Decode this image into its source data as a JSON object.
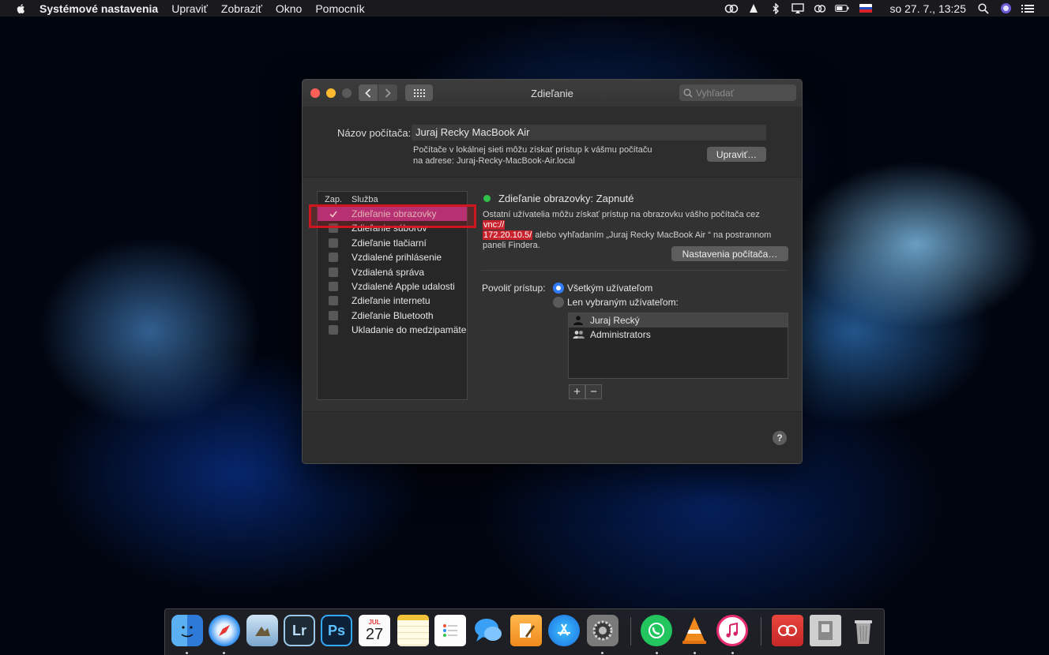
{
  "menubar": {
    "app_name": "Systémové nastavenia",
    "menus": [
      "Upraviť",
      "Zobraziť",
      "Okno",
      "Pomocník"
    ],
    "clock": "so 27. 7.,  13:25"
  },
  "window": {
    "title": "Zdieľanie",
    "search_placeholder": "Vyhľadať",
    "computer_name_label": "Názov počítača:",
    "computer_name": "Juraj Recky MacBook Air",
    "address_note_line1": "Počítače v lokálnej sieti môžu získať prístup k vášmu počítaču",
    "address_note_line2": "na adrese: Juraj-Recky-MacBook-Air.local",
    "edit_button": "Upraviť…",
    "table_header_on": "Zap.",
    "table_header_service": "Služba",
    "services": [
      {
        "label": "Zdieľanie obrazovky",
        "checked": true,
        "selected": true
      },
      {
        "label": "Zdieľanie súborov",
        "checked": false
      },
      {
        "label": "Zdieľanie tlačiarní",
        "checked": false
      },
      {
        "label": "Vzdialené prihlásenie",
        "checked": false
      },
      {
        "label": "Vzdialená správa",
        "checked": false
      },
      {
        "label": "Vzdialené Apple udalosti",
        "checked": false
      },
      {
        "label": "Zdieľanie internetu",
        "checked": false
      },
      {
        "label": "Zdieľanie Bluetooth",
        "checked": false
      },
      {
        "label": "Ukladanie do medzipamäte",
        "checked": false
      }
    ],
    "status_text": "Zdieľanie obrazovky: Zapnuté",
    "status_color": "#30c14a",
    "access_note_prefix": "Ostatní užívatelia môžu získať prístup na obrazovku vášho počítača cez ",
    "vnc_part1": "vnc://",
    "vnc_part2": "172.20.10.5/",
    "access_note_suffix": " alebo vyhľadaním „Juraj Recky MacBook Air “ na postrannom paneli Findera.",
    "computer_settings_button": "Nastavenia počítača…",
    "allow_access_label": "Povoliť prístup:",
    "radio_all": "Všetkým užívateľom",
    "radio_selected": "Len vybraným užívateľom:",
    "users": [
      "Juraj Recký",
      "Administrators"
    ],
    "plus_label": "+",
    "minus_label": "−",
    "help_label": "?"
  },
  "dock": {
    "apps": [
      "Finder",
      "Safari",
      "Preview",
      "Lightroom",
      "Photoshop",
      "Calendar",
      "Notes",
      "Reminders",
      "Messages",
      "Pages",
      "App Store",
      "System Preferences",
      "WhatsApp",
      "VLC",
      "iTunes",
      "Creative Cloud",
      "Documents",
      "Trash"
    ],
    "calendar_month": "JUL",
    "calendar_day": "27",
    "lightroom_label": "Lr",
    "photoshop_label": "Ps"
  },
  "colors": {
    "selection": "#b23a8c",
    "highlight": "#c8232c",
    "radio_accent": "#2f7cf6"
  }
}
